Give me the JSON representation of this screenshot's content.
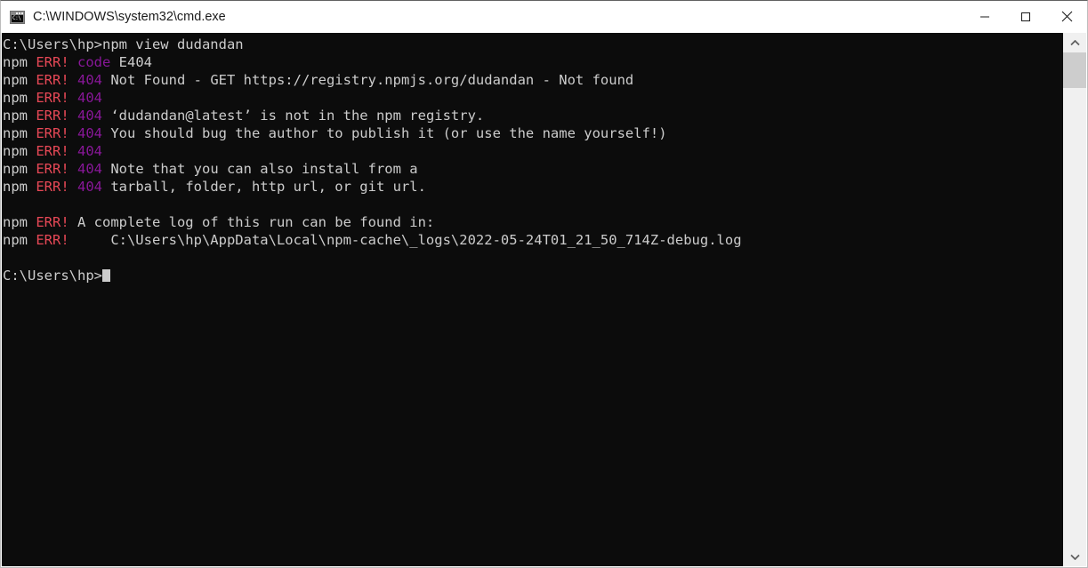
{
  "window": {
    "title": "C:\\WINDOWS\\system32\\cmd.exe",
    "icon": "cmd-console-icon",
    "controls": {
      "minimize": "minimize-button",
      "maximize": "maximize-button",
      "close": "close-button"
    }
  },
  "colors": {
    "background": "#0c0c0c",
    "foreground": "#cccccc",
    "error_red": "#e74856",
    "magenta": "#881798",
    "titlebar_bg": "#ffffff",
    "scrollbar_track": "#f0f0f0",
    "scrollbar_thumb": "#cdcdcd"
  },
  "terminal": {
    "prompt": "C:\\Users\\hp>",
    "command": "npm view dudandan",
    "cursor": "block",
    "lines": [
      {
        "type": "prompt",
        "prompt": "C:\\Users\\hp>",
        "command": "npm view dudandan"
      },
      {
        "type": "err",
        "prefix": "npm",
        "tag": "ERR!",
        "code": "code",
        "text": " E404"
      },
      {
        "type": "err",
        "prefix": "npm",
        "tag": "ERR!",
        "code": "404",
        "text": " Not Found - GET https://registry.npmjs.org/dudandan - Not found"
      },
      {
        "type": "err",
        "prefix": "npm",
        "tag": "ERR!",
        "code": "404",
        "text": ""
      },
      {
        "type": "err",
        "prefix": "npm",
        "tag": "ERR!",
        "code": "404",
        "text": " ‘dudandan@latest’ is not in the npm registry."
      },
      {
        "type": "err",
        "prefix": "npm",
        "tag": "ERR!",
        "code": "404",
        "text": " You should bug the author to publish it (or use the name yourself!)"
      },
      {
        "type": "err",
        "prefix": "npm",
        "tag": "ERR!",
        "code": "404",
        "text": ""
      },
      {
        "type": "err",
        "prefix": "npm",
        "tag": "ERR!",
        "code": "404",
        "text": " Note that you can also install from a"
      },
      {
        "type": "err",
        "prefix": "npm",
        "tag": "ERR!",
        "code": "404",
        "text": " tarball, folder, http url, or git url."
      },
      {
        "type": "blank"
      },
      {
        "type": "err",
        "prefix": "npm",
        "tag": "ERR!",
        "code": "",
        "text": " A complete log of this run can be found in:"
      },
      {
        "type": "err",
        "prefix": "npm",
        "tag": "ERR!",
        "code": "",
        "text": "     C:\\Users\\hp\\AppData\\Local\\npm-cache\\_logs\\2022-05-24T01_21_50_714Z-debug.log"
      },
      {
        "type": "blank"
      },
      {
        "type": "prompt",
        "prompt": "C:\\Users\\hp>",
        "command": ""
      }
    ]
  },
  "scrollbar": {
    "up_arrow": "scroll-up-icon",
    "down_arrow": "scroll-down-icon",
    "thumb": "scrollbar-thumb"
  }
}
